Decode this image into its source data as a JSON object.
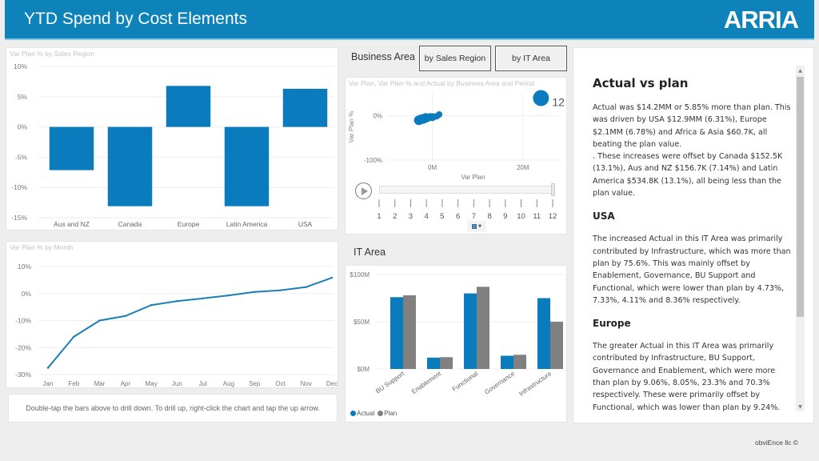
{
  "header": {
    "title": "YTD Spend by Cost Elements",
    "logo": "ARRIA"
  },
  "colors": {
    "header_bg": "#0d83b9",
    "accent": "#0a7bbd",
    "plan": "#808080",
    "page_bg": "#eeeeee"
  },
  "region_chart": {
    "title": "Var Plan % by Sales Region"
  },
  "month_chart": {
    "title": "Var Plan % by Month"
  },
  "note": "Double-tap the bars above to drill down. To drill up, right-click the chart and tap the up arrow.",
  "business_area": {
    "label": "Business Area",
    "buttons": [
      {
        "label": "by Sales Region"
      },
      {
        "label": "by IT Area"
      }
    ]
  },
  "scatter": {
    "title": "Var Plan, Var Plan % and Actual by Business Area and Period",
    "period_label": "12",
    "play_axis": {
      "ticks": [
        "1",
        "2",
        "3",
        "4",
        "5",
        "6",
        "7",
        "8",
        "9",
        "10",
        "11",
        "12"
      ],
      "current_period": 12
    }
  },
  "it_area": {
    "label": "IT Area",
    "legend": [
      {
        "name": "Actual",
        "color": "#0a7bbd"
      },
      {
        "name": "Plan",
        "color": "#808080"
      }
    ]
  },
  "narrative": {
    "heading": "Actual vs plan",
    "intro": "Actual was $14.2MM or 5.85% more than plan. This was driven by USA $12.9MM (6.31%), Europe $2.1MM (6.78%) and Africa & Asia $60.7K, all beating the plan value.\n. These increases were offset by Canada $152.5K (13.1%), Aus and NZ $156.7K (7.14%) and Latin America $534.8K (13.1%), all being less than the plan value.",
    "sections": [
      {
        "heading": "USA",
        "text": "The increased Actual in this IT Area was primarily contributed by Infrastructure, which was more than plan by 75.6%. This was mainly offset by Enablement, Governance, BU Support and Functional, which were lower than plan by 4.73%, 7.33%, 4.11% and 8.36% respectively."
      },
      {
        "heading": "Europe",
        "text": "The greater Actual in this IT Area was primarily contributed by Infrastructure, BU Support, Governance and Enablement, which were more than plan by 9.06%, 8.05%, 23.3% and 70.3% respectively. These were primarily offset by Functional, which was lower than plan by 9.24%."
      }
    ]
  },
  "footer": {
    "credit": "obviEnce llc ©"
  },
  "chart_data": [
    {
      "id": "region",
      "type": "bar",
      "title": "Var Plan % by Sales Region",
      "categories": [
        "Aus and NZ",
        "Canada",
        "Europe",
        "Latin America",
        "USA"
      ],
      "values": [
        -7.14,
        -13.1,
        6.78,
        -13.1,
        6.31
      ],
      "ylim": [
        -15,
        10
      ],
      "yticks": [
        10,
        5,
        0,
        -5,
        -10,
        -15
      ],
      "ytick_labels": [
        "10%",
        "5%",
        "0%",
        "-5%",
        "-10%",
        "-15%"
      ],
      "grid": true,
      "color": "#0a7bbd"
    },
    {
      "id": "month",
      "type": "line",
      "title": "Var Plan % by Month",
      "categories": [
        "Jan",
        "Feb",
        "Mar",
        "Apr",
        "May",
        "Jun",
        "Jul",
        "Aug",
        "Sep",
        "Oct",
        "Nov",
        "Dec"
      ],
      "values": [
        -27.5,
        -16,
        -10,
        -8.3,
        -4.3,
        -2.8,
        -1.8,
        -0.7,
        0.6,
        1.2,
        2.4,
        5.85
      ],
      "ylim": [
        -30,
        10
      ],
      "yticks": [
        10,
        0,
        -10,
        -20,
        -30
      ],
      "ytick_labels": [
        "10%",
        "0%",
        "-10%",
        "-20%",
        "-30%"
      ],
      "grid": true,
      "color": "#1a7fb5"
    },
    {
      "id": "scatter",
      "type": "scatter",
      "title": "Var Plan, Var Plan % and Actual by Business Area and Period",
      "xlabel": "Var Plan",
      "ylabel": "Var Plan %",
      "xticks": [
        0,
        20
      ],
      "xtick_labels": [
        "0M",
        "20M"
      ],
      "yticks": [
        0,
        -100
      ],
      "ytick_labels": [
        "0%",
        "-100%"
      ],
      "xlim": [
        -10,
        28
      ],
      "ylim": [
        -100,
        50
      ],
      "points": [
        {
          "x": -3,
          "y": -10,
          "r": 6
        },
        {
          "x": -2.5,
          "y": -8,
          "r": 6
        },
        {
          "x": -2,
          "y": -7,
          "r": 6
        },
        {
          "x": -1.5,
          "y": -5,
          "r": 6
        },
        {
          "x": -1,
          "y": -4,
          "r": 5
        },
        {
          "x": -0.5,
          "y": -3,
          "r": 5
        },
        {
          "x": 0,
          "y": -3,
          "r": 5
        },
        {
          "x": 0.5,
          "y": -2,
          "r": 4
        },
        {
          "x": 1,
          "y": -1,
          "r": 4
        },
        {
          "x": 1.5,
          "y": 3,
          "r": 4
        },
        {
          "x": 24,
          "y": 40,
          "r": 10,
          "label": "12"
        }
      ],
      "color": "#0a7bbd"
    },
    {
      "id": "it_area",
      "type": "bar",
      "title": "IT Area",
      "categories": [
        "BU Support",
        "Enablement",
        "Functional",
        "Governance",
        "Infrastructure"
      ],
      "series": [
        {
          "name": "Actual",
          "values": [
            76,
            12,
            80,
            14,
            75
          ],
          "color": "#0a7bbd"
        },
        {
          "name": "Plan",
          "values": [
            78,
            12.5,
            87,
            15,
            50
          ],
          "color": "#808080"
        }
      ],
      "ylim": [
        0,
        100
      ],
      "yticks": [
        100,
        50,
        0
      ],
      "ytick_labels": [
        "$100M",
        "$50M",
        "$0M"
      ],
      "grid": true,
      "legend": "bottom-left"
    }
  ]
}
